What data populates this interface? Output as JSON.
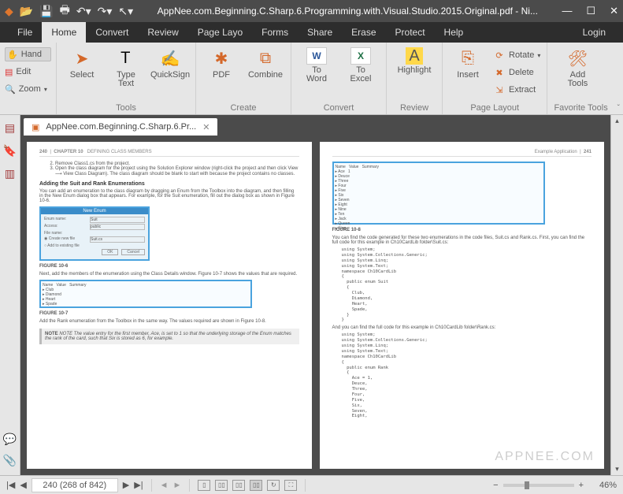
{
  "window": {
    "title": "AppNee.com.Beginning.C.Sharp.6.Programming.with.Visual.Studio.2015.Original.pdf - Ni..."
  },
  "menubar": {
    "file": "File",
    "home": "Home",
    "convert": "Convert",
    "review": "Review",
    "pagelayout": "Page Layo",
    "forms": "Forms",
    "share": "Share",
    "erase": "Erase",
    "protect": "Protect",
    "help": "Help",
    "login": "Login"
  },
  "lefttools": {
    "hand": "Hand",
    "edit": "Edit",
    "zoom": "Zoom"
  },
  "ribbon": {
    "select": "Select",
    "typetext": "Type\nText",
    "quicksign": "QuickSign",
    "tools_title": "Tools",
    "pdf": "PDF",
    "combine": "Combine",
    "create_title": "Create",
    "toword": "To\nWord",
    "toexcel": "To\nExcel",
    "convert_title": "Convert",
    "highlight": "Highlight",
    "review_title": "Review",
    "insert": "Insert",
    "rotate": "Rotate",
    "delete": "Delete",
    "extract": "Extract",
    "pagelayout_title": "Page Layout",
    "addtools": "Add\nTools",
    "favtools_title": "Favorite Tools"
  },
  "doctab": {
    "label": "AppNee.com.Beginning.C.Sharp.6.Pr..."
  },
  "pageleft": {
    "pgnum": "240",
    "chap": "CHAPTER 10",
    "sect": "DEFINING CLASS MEMBERS",
    "li2": "Remove Class1.cs from the project.",
    "li3": "Open the class diagram for the project using the Solution Explorer window (right-click the project and then click View ⟶ View Class Diagram). The class diagram should be blank to start with because the project contains no classes.",
    "h1": "Adding the Suit and Rank Enumerations",
    "p1": "You can add an enumeration to the class diagram by dragging an Enum from the Toolbox into the diagram, and then filling in the New Enum dialog box that appears. For example, for the Suit enumeration, fill out the dialog box as shown in Figure 10-6.",
    "dlg_title": "New Enum",
    "dlg_f1": "Enum name:",
    "dlg_v1": "Suit",
    "dlg_f2": "Access:",
    "dlg_v2": "public",
    "dlg_f3": "File name:",
    "dlg_r1": "Create new file",
    "dlg_r1v": "Suit.cs",
    "dlg_r2": "Add to existing file",
    "dlg_ok": "OK",
    "dlg_cancel": "Cancel",
    "fig1": "FIGURE 10-6",
    "p2": "Next, add the members of the enumeration using the Class Details window. Figure 10-7 shows the values that are required.",
    "fig2": "FIGURE 10-7",
    "p3": "Add the Rank enumeration from the Toolbox in the same way. The values required are shown in Figure 10-8.",
    "note": "NOTE  The value entry for the first member, Ace, is set to 1 so that the underlying storage of the Enum matches the rank of the card, such that Six is stored as 6, for example."
  },
  "pageright": {
    "hdr": "Example Application",
    "pgnum": "241",
    "fig": "FIGURE 10-8",
    "p1": "You can find the code generated for these two enumerations in the code files, Suit.cs and Rank.cs. First, you can find the full code for this example in Ch10CardLib folder\\Suit.cs:",
    "code1": "using System;\nusing System.Collections.Generic;\nusing System.Linq;\nusing System.Text;\nnamespace Ch10CardLib\n{\n  public enum Suit\n  {\n    Club,\n    Diamond,\n    Heart,\n    Spade,\n  }\n}",
    "p2": "And you can find the full code for this example in Ch10CardLib folder\\Rank.cs:",
    "code2": "using System;\nusing System.Collections.Generic;\nusing System.Linq;\nusing System.Text;\nnamespace Ch10CardLib\n{\n  public enum Rank\n  {\n    Ace = 1,\n    Deuce,\n    Three,\n    Four,\n    Five,\n    Six,\n    Seven,\n    Eight,"
  },
  "watermark": "APPNEE.COM",
  "status": {
    "page_display": "240 (268 of 842)",
    "zoom": "46%"
  }
}
